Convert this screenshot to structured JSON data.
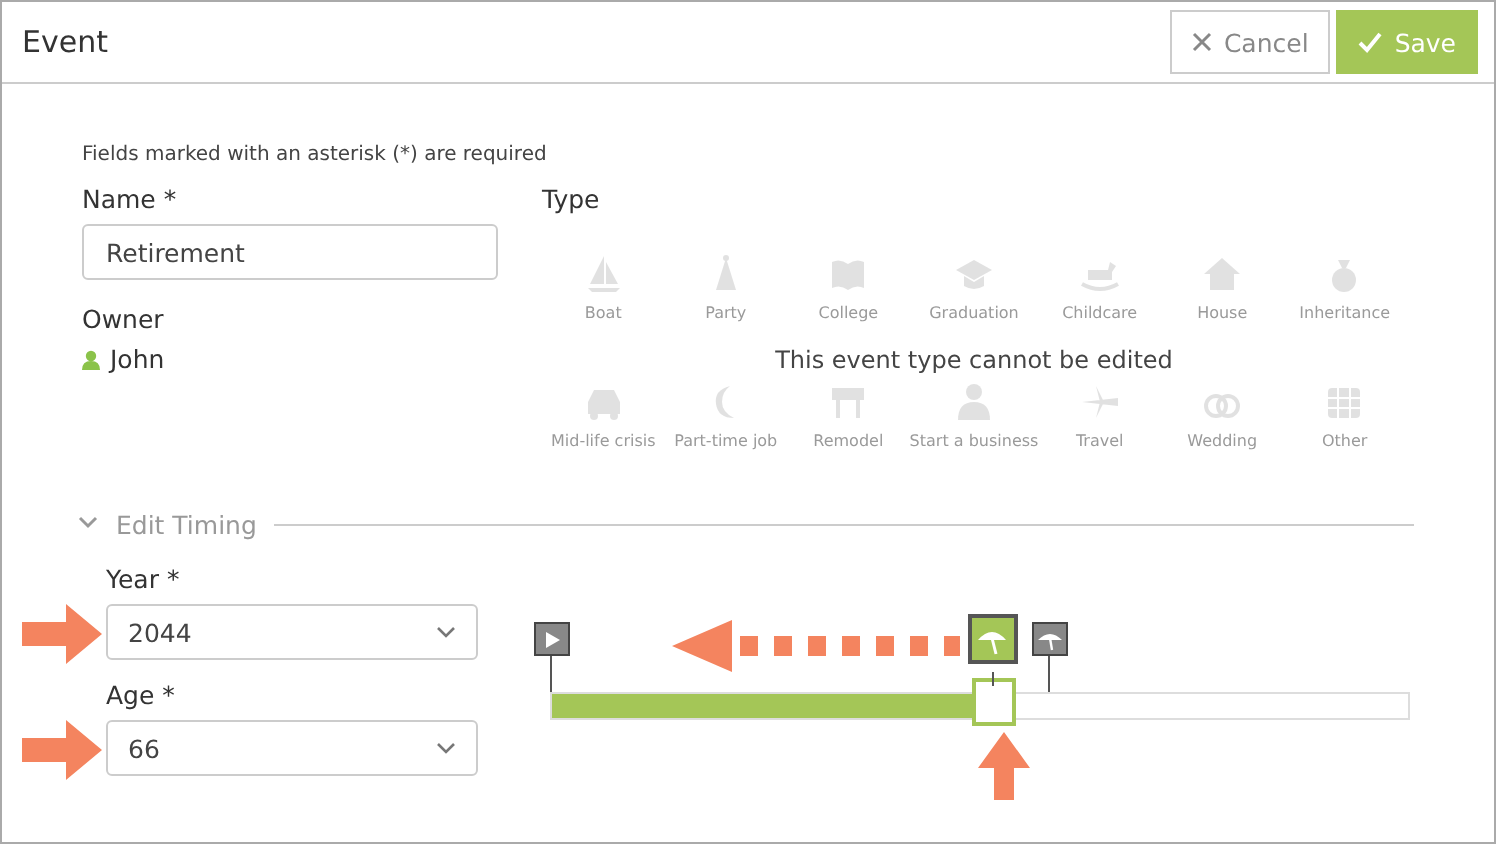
{
  "window": {
    "title": "Event"
  },
  "buttons": [
    {
      "label": "Cancel",
      "kind": "cancel"
    },
    {
      "label": "Save",
      "kind": "save"
    }
  ],
  "note": "Fields marked with an asterisk (*) are required",
  "name_field": {
    "label": "Name *",
    "value": "Retirement"
  },
  "owner": {
    "label": "Owner",
    "value": "John"
  },
  "type": {
    "label": "Type",
    "disabled": true,
    "message": "This event type cannot be edited",
    "options": [
      "Boat",
      "Party",
      "College",
      "Graduation",
      "Childcare",
      "House",
      "Inheritance",
      "Mid-life crisis",
      "Part-time job",
      "Remodel",
      "Start a business",
      "Travel",
      "Wedding",
      "Other"
    ]
  },
  "timing": {
    "title": "Edit Timing",
    "expanded": true,
    "fields": [
      {
        "label": "Year *",
        "value": "2044"
      },
      {
        "label": "Age *",
        "value": "66"
      }
    ],
    "timeline": {
      "level": 0.49
    }
  }
}
